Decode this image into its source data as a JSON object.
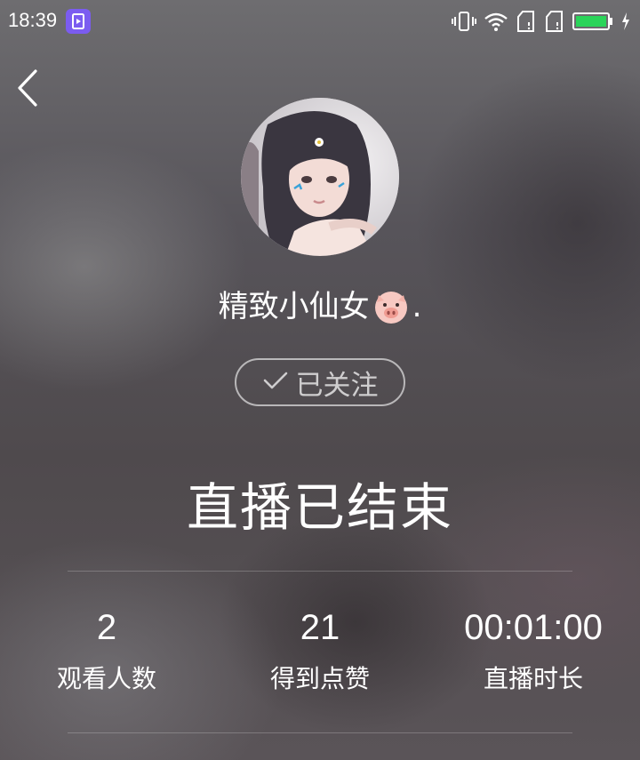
{
  "status_bar": {
    "time": "18:39",
    "icons": [
      "app-notification-icon",
      "vibrate-icon",
      "wifi-icon",
      "sim-card-icon",
      "sim-card-icon",
      "battery-icon",
      "charging-icon"
    ],
    "battery_color": "#2bd45a"
  },
  "header": {
    "back_icon": "chevron-left-icon"
  },
  "streamer": {
    "nickname": "精致小仙女",
    "nickname_suffix": ".",
    "nickname_emoji": "pig-face-icon",
    "follow_label": "已关注",
    "follow_icon": "checkmark-icon"
  },
  "live": {
    "ended_title": "直播已结束"
  },
  "stats": {
    "viewers": {
      "value": "2",
      "label": "观看人数"
    },
    "likes": {
      "value": "21",
      "label": "得到点赞"
    },
    "duration": {
      "value": "00:01:00",
      "label": "直播时长"
    }
  }
}
